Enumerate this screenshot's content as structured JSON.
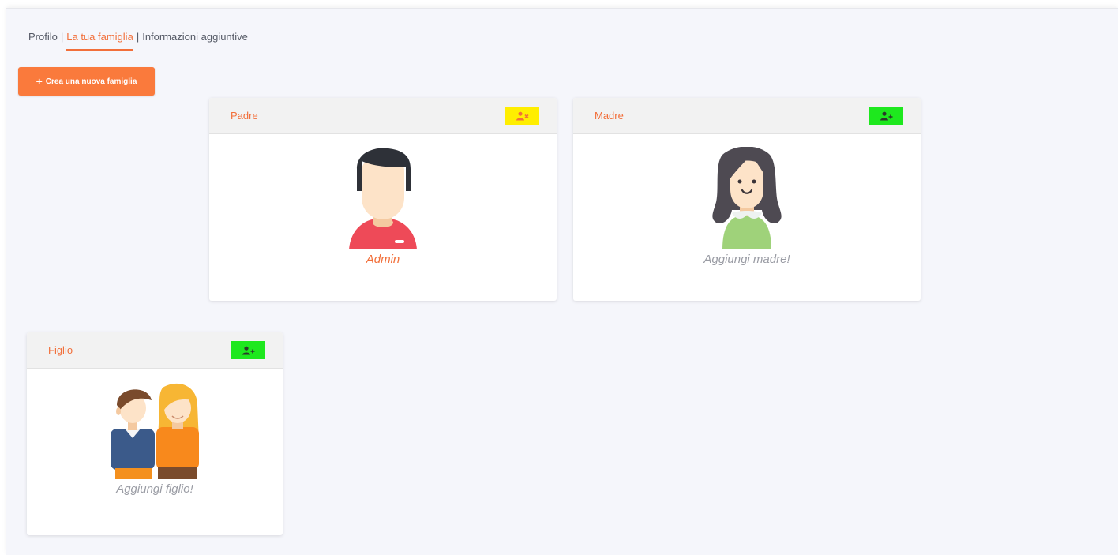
{
  "tabs": [
    {
      "label": "Profilo"
    },
    {
      "label": "La tua famiglia"
    },
    {
      "label": "Informazioni aggiuntive"
    }
  ],
  "tab_separator": "|",
  "active_tab_index": 1,
  "new_family_button": {
    "icon": "plus-icon",
    "label": "Crea una nuova famiglia"
  },
  "cards": {
    "father": {
      "title": "Padre",
      "caption": "Admin",
      "action_icon": "remove-user-icon",
      "action_color": "#ffee00"
    },
    "mother": {
      "title": "Madre",
      "caption": "Aggiungi madre!",
      "action_icon": "add-user-icon",
      "action_color": "#1ee81e"
    },
    "child": {
      "title": "Figlio",
      "caption": "Aggiungi figlio!",
      "action_icon": "add-user-icon",
      "action_color": "#1ee81e"
    }
  },
  "colors": {
    "accent": "#f26f3a",
    "button": "#fa7a3c",
    "background": "#f5f6fb"
  }
}
